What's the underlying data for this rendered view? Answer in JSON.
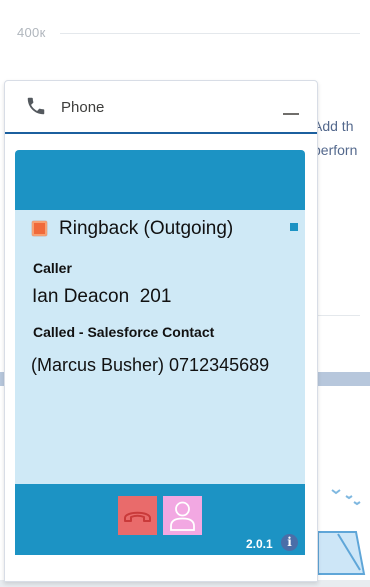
{
  "background": {
    "axis_label": "400к",
    "side_text_line1": "Add th",
    "side_text_line2": "perforn"
  },
  "phone_panel": {
    "title": "Phone",
    "icons": {
      "phone": "phone-icon",
      "minimize": "minimize-icon"
    }
  },
  "softphone": {
    "status": "Ringback (Outgoing)",
    "caller_label": "Caller",
    "caller_value": "Ian Deacon  201",
    "called_label": "Called - Salesforce Contact",
    "called_value": "(Marcus Busher) 0712345689",
    "version": "2.0.1",
    "info_label": "i",
    "icons": {
      "hangup": "hangup-icon",
      "contact": "contact-icon",
      "info": "info-icon"
    },
    "colors": {
      "bar": "#1c93c4",
      "body": "#cfe9f6",
      "hangup": "#e96b6b",
      "contact": "#f2a8e2",
      "status_led": "#f06a3b"
    }
  }
}
